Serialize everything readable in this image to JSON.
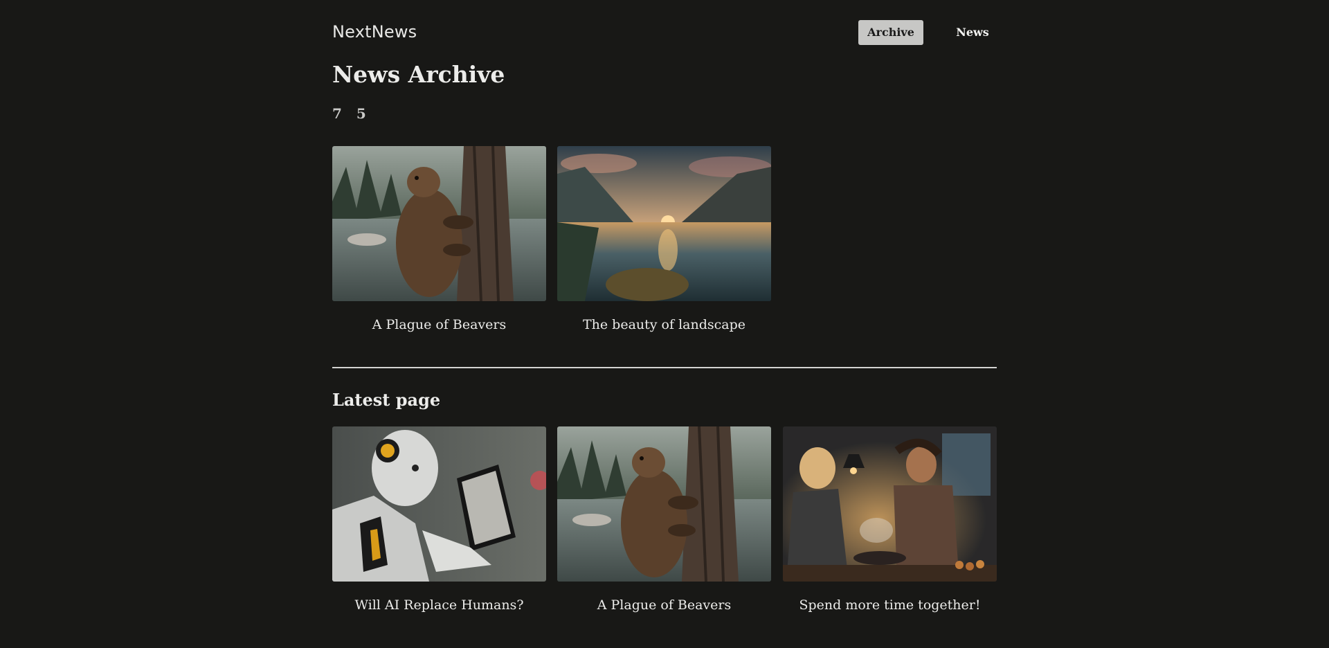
{
  "header": {
    "logo": "NextNews",
    "nav": {
      "archive_label": "Archive",
      "news_label": "News"
    }
  },
  "archive": {
    "title": "News Archive",
    "pages": [
      "7",
      "5"
    ],
    "cards": [
      {
        "title": "A Plague of Beavers",
        "image": "beaver-photo"
      },
      {
        "title": "The beauty of landscape",
        "image": "mountain-lake-landscape-photo"
      }
    ]
  },
  "latest": {
    "title": "Latest page",
    "cards": [
      {
        "title": "Will AI Replace Humans?",
        "image": "robot-with-tablet-photo"
      },
      {
        "title": "A Plague of Beavers",
        "image": "beaver-photo"
      },
      {
        "title": "Spend more time together!",
        "image": "couple-cooking-photo"
      }
    ]
  },
  "colors": {
    "background": "#181816",
    "text": "#ececea",
    "nav_active_bg": "#c7c7c5"
  }
}
